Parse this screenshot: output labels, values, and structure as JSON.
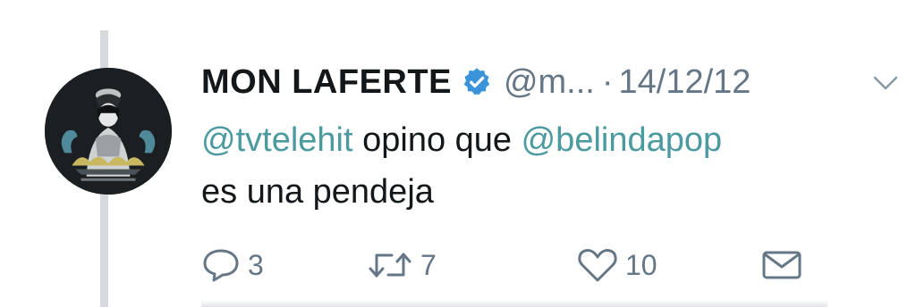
{
  "tweet": {
    "author_name": "MON LAFERTE",
    "handle": "@m...",
    "separator": "·",
    "date": "14/12/12",
    "text": {
      "mention1": "@tvtelehit",
      "middle": " opino que ",
      "mention2": "@belindapop",
      "line2": "es una pendeja"
    }
  },
  "actions": {
    "reply": {
      "icon": "reply-icon",
      "count": "3"
    },
    "retweet": {
      "icon": "retweet-icon",
      "count": "7"
    },
    "like": {
      "icon": "heart-icon",
      "count": "10"
    },
    "dm": {
      "icon": "envelope-icon"
    }
  },
  "colors": {
    "text": "#14171a",
    "secondary": "#657786",
    "link": "#4a9aa0",
    "verified": "#3b94d9",
    "thread_line": "#d6dadd"
  }
}
